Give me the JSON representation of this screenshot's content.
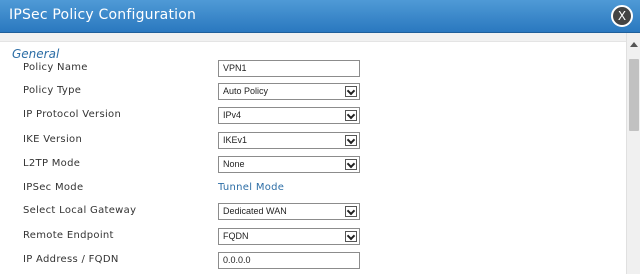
{
  "dialog": {
    "title": "IPSec Policy Configuration",
    "close_glyph": "X"
  },
  "section": {
    "title": "General"
  },
  "fields": [
    {
      "label": "Policy Name",
      "type": "text",
      "value": "VPN1"
    },
    {
      "label": "Policy Type",
      "type": "select",
      "value": "Auto Policy"
    },
    {
      "label": "IP Protocol Version",
      "type": "select",
      "value": "IPv4"
    },
    {
      "label": "IKE Version",
      "type": "select",
      "value": "IKEv1"
    },
    {
      "label": "L2TP Mode",
      "type": "select",
      "value": "None"
    },
    {
      "label": "IPSec Mode",
      "type": "static",
      "value": "Tunnel Mode"
    },
    {
      "label": "Select Local Gateway",
      "type": "select",
      "value": "Dedicated WAN"
    },
    {
      "label": "Remote Endpoint",
      "type": "select",
      "value": "FQDN"
    },
    {
      "label": "IP Address / FQDN",
      "type": "text",
      "value": "0.0.0.0"
    }
  ],
  "colors": {
    "titlebar": "#2a78bf",
    "accent_text": "#2d6ea6"
  }
}
